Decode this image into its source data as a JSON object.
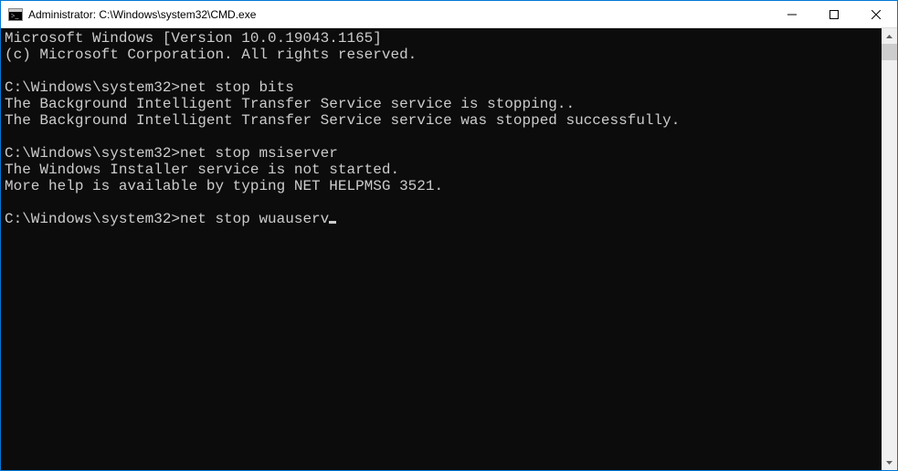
{
  "titlebar": {
    "title": "Administrator: C:\\Windows\\system32\\CMD.exe"
  },
  "console": {
    "version_line": "Microsoft Windows [Version 10.0.19043.1165]",
    "copyright_line": "(c) Microsoft Corporation. All rights reserved.",
    "blocks": [
      {
        "prompt": "C:\\Windows\\system32>",
        "command": "net stop bits",
        "output": [
          "The Background Intelligent Transfer Service service is stopping..",
          "The Background Intelligent Transfer Service service was stopped successfully.",
          ""
        ]
      },
      {
        "prompt": "C:\\Windows\\system32>",
        "command": "net stop msiserver",
        "output": [
          "The Windows Installer service is not started.",
          "",
          "More help is available by typing NET HELPMSG 3521.",
          ""
        ]
      }
    ],
    "current_prompt": "C:\\Windows\\system32>",
    "current_command": "net stop wuauserv"
  }
}
